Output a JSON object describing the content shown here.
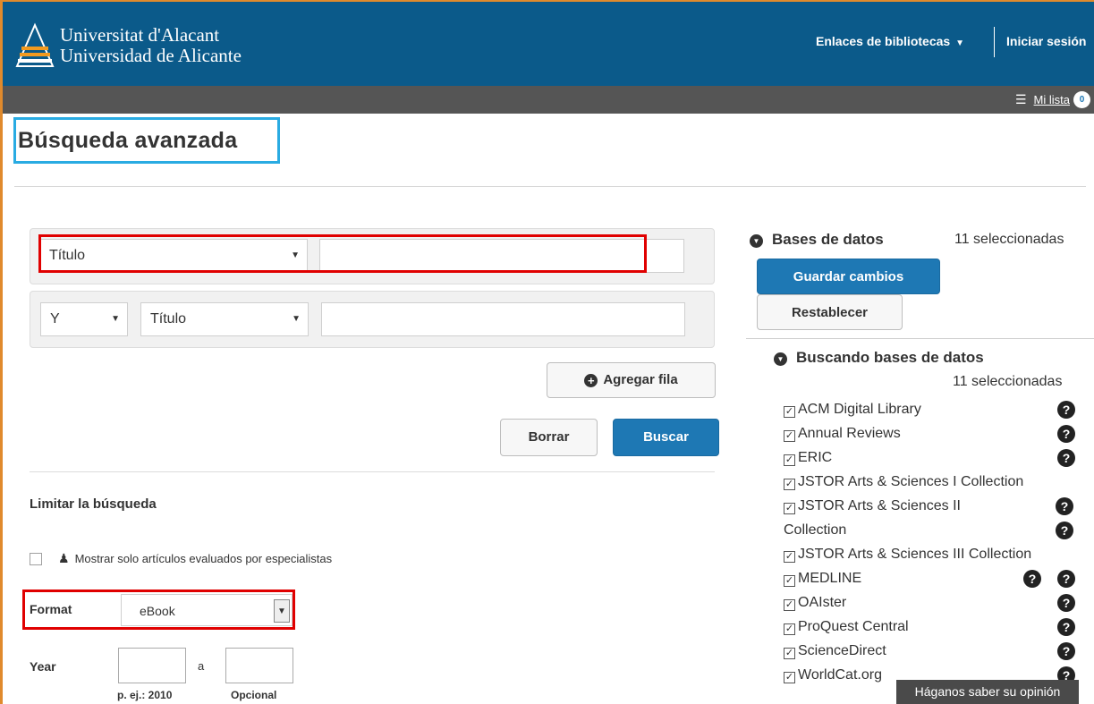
{
  "header": {
    "brand_line1": "Universitat d'Alacant",
    "brand_line2": "Universidad de Alicante",
    "library_links": "Enlaces de bibliotecas",
    "sign_in": "Iniciar sesión",
    "my_list_label": "Mi lista",
    "my_list_count": "0"
  },
  "page": {
    "title": "Búsqueda avanzada"
  },
  "search": {
    "row1_field": "Título",
    "row1_value": "",
    "row2_operator": "Y",
    "row2_field": "Título",
    "row2_value": "",
    "add_row": "Agregar fila",
    "clear": "Borrar",
    "search": "Buscar"
  },
  "limit": {
    "title": "Limitar la búsqueda",
    "peer_reviewed": "Mostrar solo artículos evaluados por especialistas",
    "format_label": "Format",
    "format_value": "eBook",
    "year_label": "Year",
    "year_sep": "a",
    "year_hint_from": "p. ej.: 2010",
    "year_hint_to": "Opcional"
  },
  "databases": {
    "heading": "Bases de datos",
    "selected_count": "11 seleccionadas",
    "save": "Guardar cambios",
    "reset": "Restablecer",
    "searching_heading": "Buscando bases de datos",
    "searching_count": "11 seleccionadas",
    "items": [
      {
        "label": "ACM Digital Library"
      },
      {
        "label": "Annual Reviews"
      },
      {
        "label": "ERIC"
      },
      {
        "label": "JSTOR Arts & Sciences I Collection"
      },
      {
        "label": "JSTOR Arts & Sciences II Collection"
      },
      {
        "label": "JSTOR Arts & Sciences III Collection"
      },
      {
        "label": "MEDLINE"
      },
      {
        "label": "OAIster"
      },
      {
        "label": "ProQuest Central"
      },
      {
        "label": "ScienceDirect"
      },
      {
        "label": "WorldCat.org"
      }
    ]
  },
  "feedback": {
    "label": "Háganos saber su opinión"
  },
  "icons": {
    "list": "list-icon",
    "help": "question-circle-icon",
    "caret": "caret-down-icon",
    "plus": "plus-circle-icon"
  },
  "colors": {
    "header_bg": "#0b5a8a",
    "subbar_bg": "#555555",
    "primary_button": "#1e78b4",
    "title_highlight": "#29abe2",
    "annotation_red": "#e00000"
  }
}
